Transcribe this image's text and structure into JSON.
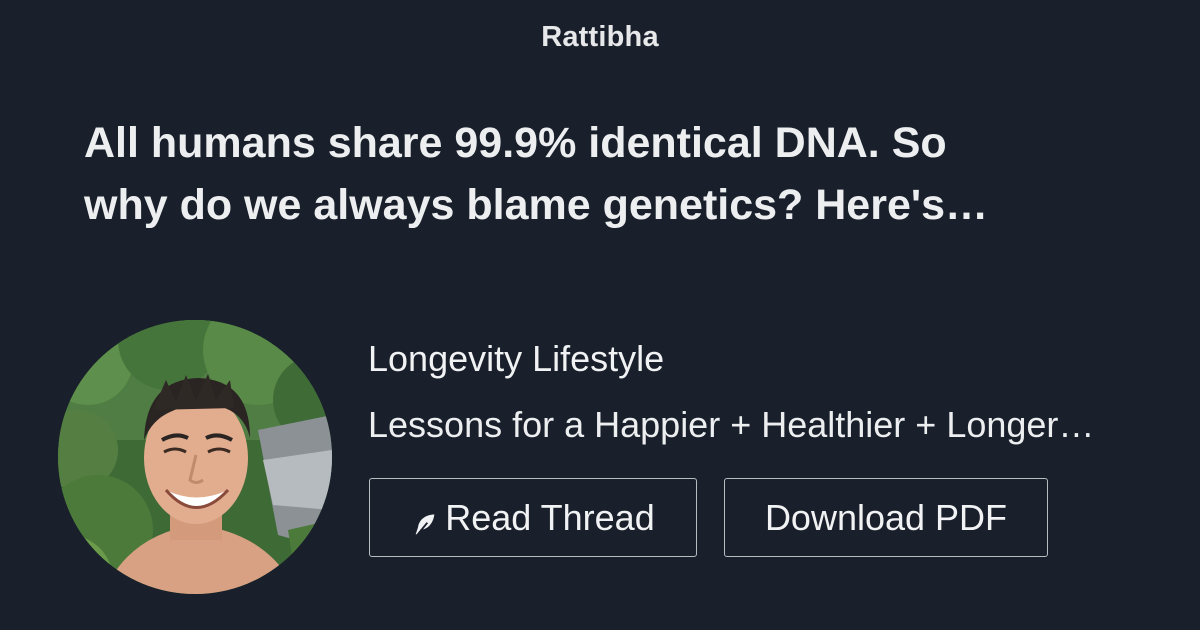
{
  "brand": "Rattibha",
  "thread": {
    "title_line_1": "All humans share 99.9% identical DNA. So",
    "title_line_2": "why do we always blame genetics? Here's…"
  },
  "author": {
    "name": "Longevity Lifestyle",
    "bio": "Lessons for a Happier + Healthier + Longer…"
  },
  "actions": {
    "read_label": "Read Thread",
    "read_icon": "feather-icon",
    "pdf_label": "Download PDF"
  },
  "colors": {
    "background": "#19202b",
    "text": "#f1f2f3",
    "button_border": "#b9bcc1"
  }
}
